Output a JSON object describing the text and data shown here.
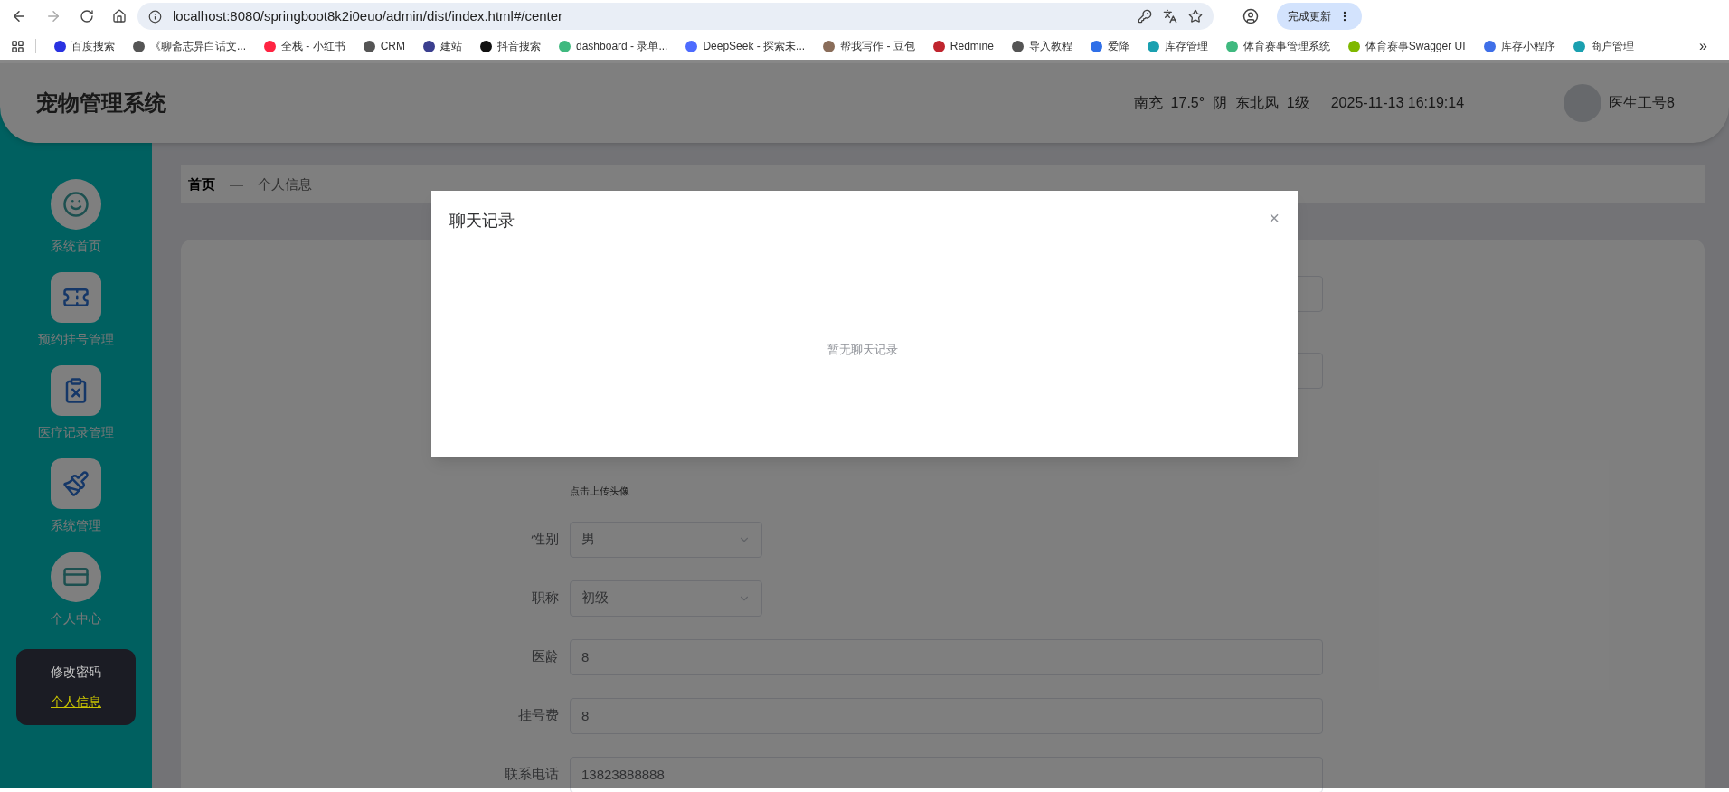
{
  "browser": {
    "url": "localhost:8080/springboot8k2i0euo/admin/dist/index.html#/center",
    "update_button": "完成更新",
    "bookmarks": [
      {
        "label": "百度搜索",
        "color": "#2932e1"
      },
      {
        "label": "《聊斋志异白话文...",
        "color": "#555555"
      },
      {
        "label": "全栈 - 小红书",
        "color": "#ff2442"
      },
      {
        "label": "CRM",
        "color": "#555555"
      },
      {
        "label": "建站",
        "color": "#3b3f8f"
      },
      {
        "label": "抖音搜索",
        "color": "#111111"
      },
      {
        "label": "dashboard - 录单...",
        "color": "#3fb97f"
      },
      {
        "label": "DeepSeek - 探索未...",
        "color": "#4d6bfe"
      },
      {
        "label": "帮我写作 - 豆包",
        "color": "#8a6d5a"
      },
      {
        "label": "Redmine",
        "color": "#c0252e"
      },
      {
        "label": "导入教程",
        "color": "#555555"
      },
      {
        "label": "爱降",
        "color": "#2f6fe8"
      },
      {
        "label": "库存管理",
        "color": "#1aa0b0"
      },
      {
        "label": "体育赛事管理系统",
        "color": "#3fb97f"
      },
      {
        "label": "体育赛事Swagger UI",
        "color": "#7fb800"
      },
      {
        "label": "库存小程序",
        "color": "#3f6fe8"
      },
      {
        "label": "商户管理",
        "color": "#1aa0b0"
      }
    ],
    "more": "»"
  },
  "header": {
    "title": "宠物管理系统",
    "weather": "南充  17.5°  阴  东北风  1级",
    "datetime": "2025-11-13 16:19:14",
    "user": "医生工号8"
  },
  "sidebar": {
    "items": [
      {
        "label": "系统首页",
        "round": true
      },
      {
        "label": "预约挂号管理",
        "round": false
      },
      {
        "label": "医疗记录管理",
        "round": false
      },
      {
        "label": "系统管理",
        "round": false
      },
      {
        "label": "个人中心",
        "round": true,
        "children": [
          {
            "label": "修改密码",
            "selected": false
          },
          {
            "label": "个人信息",
            "selected": true
          }
        ]
      }
    ]
  },
  "breadcrumb": {
    "home": "首页",
    "separator": "—",
    "current": "个人信息"
  },
  "form": {
    "avatar_hint": "点击上传头像",
    "fields": [
      {
        "kind": "select",
        "label": "性别",
        "value": "男"
      },
      {
        "kind": "select",
        "label": "职称",
        "value": "初级"
      },
      {
        "kind": "input",
        "label": "医龄",
        "value": "8"
      },
      {
        "kind": "input",
        "label": "挂号费",
        "value": "8"
      },
      {
        "kind": "input",
        "label": "联系电话",
        "value": "13823888888"
      }
    ]
  },
  "dialog": {
    "title": "聊天记录",
    "close": "×",
    "empty_text": "暂无聊天记录"
  }
}
